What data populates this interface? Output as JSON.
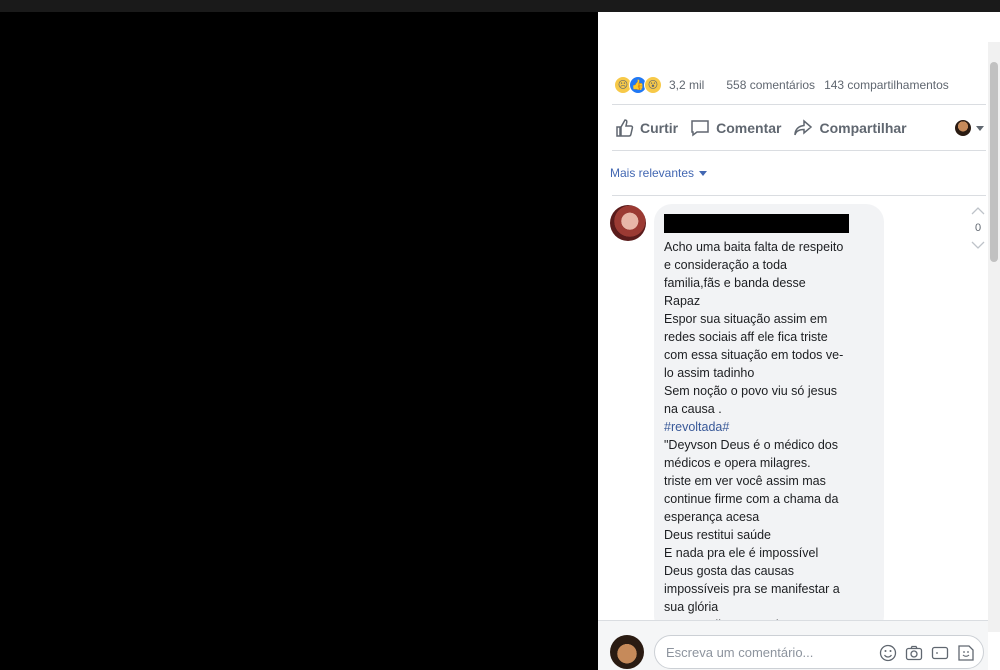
{
  "stats": {
    "reactions_count": "3,2 mil",
    "comments_count": "558 comentários",
    "shares_count": "143 compartilhamentos"
  },
  "actions": {
    "like": "Curtir",
    "comment": "Comentar",
    "share": "Compartilhar"
  },
  "sort": {
    "label": "Mais relevantes"
  },
  "comment": {
    "vote_count": "0",
    "lines": [
      "Acho uma baita falta de respeito",
      "e consideração a toda",
      "familia,fãs e banda desse",
      "Rapaz",
      "Espor sua situação assim em",
      "redes sociais aff ele fica triste",
      "com essa situação em todos ve-",
      "lo assim tadinho",
      "Sem noção o povo viu só jesus",
      "na causa ."
    ],
    "hashtag": "#revoltada#",
    "lines2": [
      "\"Deyvson Deus é o médico dos",
      "médicos e opera milagres.",
      "triste em ver você assim mas",
      "continue firme com a chama da",
      "esperança acesa",
      "Deus restitui saúde",
      "E nada pra ele é impossível",
      "Deus gosta das causas",
      "impossíveis pra se manifestar a",
      "sua glória",
      "Sempre diga a seguinte"
    ]
  },
  "composer": {
    "placeholder": "Escreva um comentário..."
  },
  "colors": {
    "link": "#4267b2",
    "muted": "#606770",
    "like_blue": "#2078f4"
  }
}
